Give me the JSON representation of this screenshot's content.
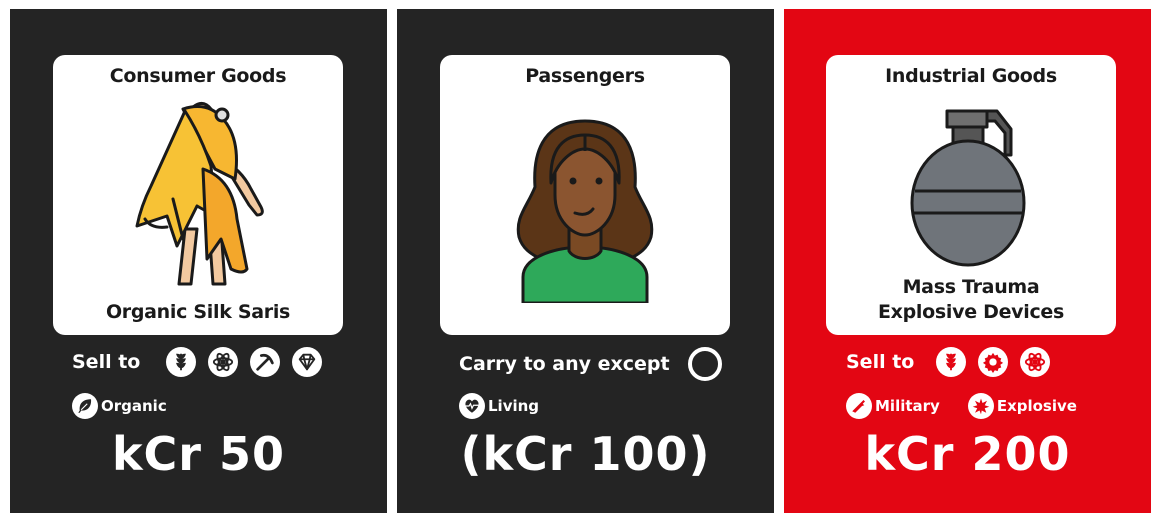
{
  "cards": [
    {
      "category": "Consumer Goods",
      "name": "Organic Silk Saris",
      "rule_label": "Sell to",
      "rule_icons": [
        "agriculture-icon",
        "science-icon",
        "mining-icon",
        "luxury-gem-icon"
      ],
      "tags": [
        {
          "label": "Organic",
          "icon": "leaf-icon"
        }
      ],
      "price": "kCr 50",
      "background": "#242424"
    },
    {
      "category": "Passengers",
      "name": "",
      "rule_label": "Carry to any except",
      "rule_icons": [
        "empty-circle-icon"
      ],
      "tags": [
        {
          "label": "Living",
          "icon": "heartbeat-icon"
        }
      ],
      "price": "(kCr 100)",
      "background": "#242424"
    },
    {
      "category": "Industrial Goods",
      "name_lines": [
        "Mass Trauma",
        "Explosive Devices"
      ],
      "rule_label": "Sell to",
      "rule_icons": [
        "agriculture-icon",
        "industrial-gear-icon",
        "science-icon"
      ],
      "tags": [
        {
          "label": "Military",
          "icon": "rifle-icon"
        },
        {
          "label": "Explosive",
          "icon": "explosion-icon"
        }
      ],
      "price": "kCr 200",
      "background": "#e30613"
    }
  ]
}
